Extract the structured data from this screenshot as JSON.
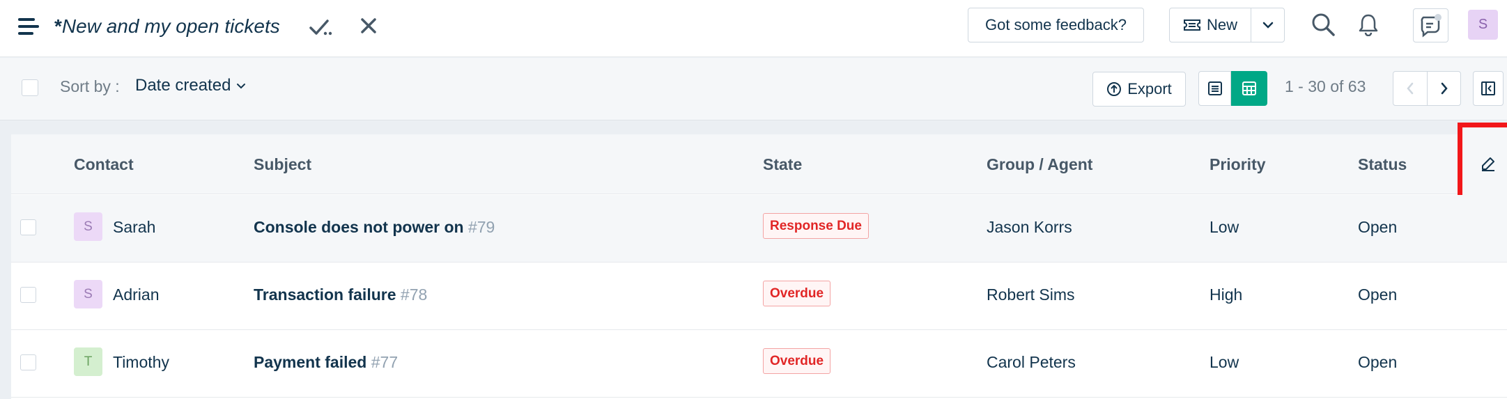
{
  "header": {
    "view_title_prefix": "*",
    "view_title": "New and my open tickets",
    "feedback_label": "Got some feedback?",
    "new_label": "New",
    "user_initial": "S"
  },
  "toolbar": {
    "sort_label": "Sort by :",
    "sort_value": "Date created",
    "export_label": "Export",
    "pagination": "1 - 30 of 63"
  },
  "columns": [
    "Contact",
    "Subject",
    "State",
    "Group / Agent",
    "Priority",
    "Status"
  ],
  "rows": [
    {
      "initial": "S",
      "contact": "Sarah",
      "subject": "Console does not power on",
      "ticket_id": "#79",
      "state": "Response Due",
      "agent": "Jason Korrs",
      "priority": "Low",
      "status": "Open",
      "avatar_bg": "#ecd9f7",
      "avatar_fg": "#9b7bb5"
    },
    {
      "initial": "S",
      "contact": "Adrian",
      "subject": "Transaction failure",
      "ticket_id": "#78",
      "state": "Overdue",
      "agent": "Robert Sims",
      "priority": "High",
      "status": "Open",
      "avatar_bg": "#ecd9f7",
      "avatar_fg": "#9b7bb5"
    },
    {
      "initial": "T",
      "contact": "Timothy",
      "subject": "Payment failed",
      "ticket_id": "#77",
      "state": "Overdue",
      "agent": "Carol Peters",
      "priority": "Low",
      "status": "Open",
      "avatar_bg": "#d4efcf",
      "avatar_fg": "#6aa360"
    }
  ],
  "colors": {
    "accent": "#00a886",
    "highlight": "#f2171a",
    "overdue": "#e12626"
  },
  "icons": [
    "menu-icon",
    "check-all-icon",
    "close-icon",
    "ticket-icon",
    "chevron-down-icon",
    "search-icon",
    "bell-icon",
    "chat-icon",
    "export-icon",
    "list-view-icon",
    "table-view-icon",
    "chevron-left-icon",
    "chevron-right-icon",
    "sidebar-toggle-icon",
    "edit-columns-icon"
  ]
}
